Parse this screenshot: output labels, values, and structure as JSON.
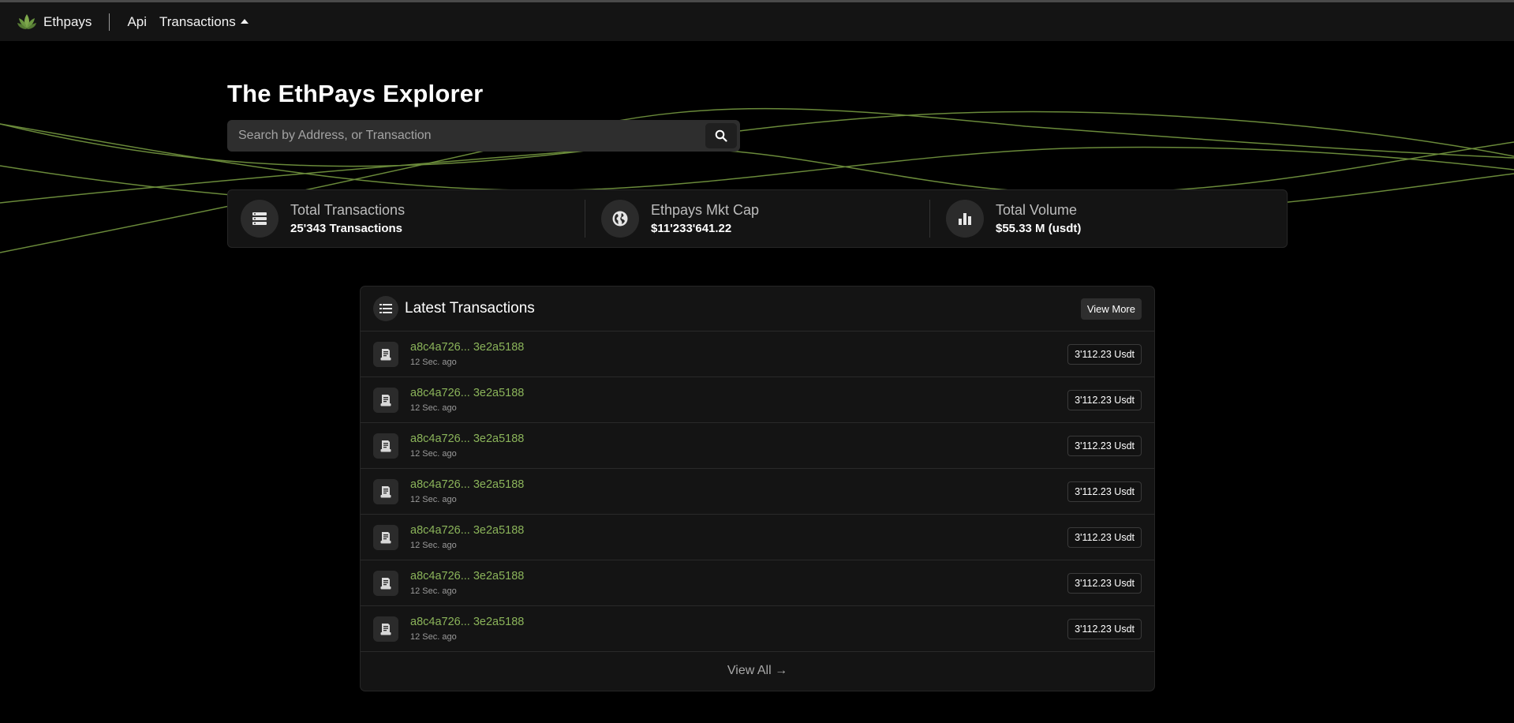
{
  "nav": {
    "brand": "Ethpays",
    "links": [
      {
        "label": "Api"
      },
      {
        "label": "Transactions"
      }
    ]
  },
  "hero": {
    "title": "The EthPays Explorer",
    "search_placeholder": "Search by Address, or Transaction",
    "search_value": ""
  },
  "stats": [
    {
      "label": "Total Transactions",
      "value": "25'343 Transactions",
      "icon": "list-icon"
    },
    {
      "label": "Ethpays Mkt Cap",
      "value": "$11'233'641.22",
      "icon": "globe-icon"
    },
    {
      "label": "Total Volume",
      "value": "$55.33 M (usdt)",
      "icon": "bar-chart-icon"
    }
  ],
  "latest": {
    "title": "Latest Transactions",
    "view_more": "View More",
    "view_all": "View All →",
    "rows": [
      {
        "hash": "a8c4a726... 3e2a5188",
        "time": "12 Sec. ago",
        "amount": "3'112.23 Usdt"
      },
      {
        "hash": "a8c4a726... 3e2a5188",
        "time": "12 Sec. ago",
        "amount": "3'112.23 Usdt"
      },
      {
        "hash": "a8c4a726... 3e2a5188",
        "time": "12 Sec. ago",
        "amount": "3'112.23 Usdt"
      },
      {
        "hash": "a8c4a726... 3e2a5188",
        "time": "12 Sec. ago",
        "amount": "3'112.23 Usdt"
      },
      {
        "hash": "a8c4a726... 3e2a5188",
        "time": "12 Sec. ago",
        "amount": "3'112.23 Usdt"
      },
      {
        "hash": "a8c4a726... 3e2a5188",
        "time": "12 Sec. ago",
        "amount": "3'112.23 Usdt"
      },
      {
        "hash": "a8c4a726... 3e2a5188",
        "time": "12 Sec. ago",
        "amount": "3'112.23 Usdt"
      }
    ]
  },
  "colors": {
    "accent": "#8bb45a",
    "wave": "#6a8a3a",
    "panel": "#141414"
  }
}
